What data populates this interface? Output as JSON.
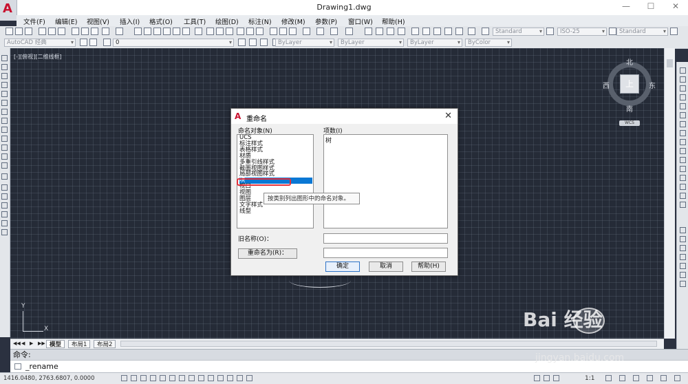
{
  "app": {
    "window_title": "Drawing1.dwg",
    "logo_letter": "A",
    "controls": {
      "minimize": "—",
      "maximize": "☐",
      "close": "✕"
    }
  },
  "menu": {
    "items": [
      "文件(F)",
      "编辑(E)",
      "视图(V)",
      "插入(I)",
      "格式(O)",
      "工具(T)",
      "绘图(D)",
      "标注(N)",
      "修改(M)",
      "参数(P)",
      "窗口(W)",
      "帮助(H)"
    ]
  },
  "toolbar": {
    "workspace": "AutoCAD 经典",
    "layer_zero": "0",
    "text_style": "Standard",
    "dim_style": "ISO-25",
    "table_style": "Standard",
    "layer_prop": "ByLayer",
    "linetype_prop": "ByLayer",
    "lineweight_prop": "ByLayer",
    "color_prop": "ByColor"
  },
  "viewport": {
    "label": "[-][俯视][二维线框]",
    "compass": {
      "north": "北",
      "south": "南",
      "east": "东",
      "west": "西",
      "center": "上"
    },
    "wcs": "WCS",
    "axis_y": "Y",
    "axis_x": "X"
  },
  "layout_tabs": {
    "nav": [
      "◀◀",
      "◀",
      "▶",
      "▶▶"
    ],
    "items": [
      "模型",
      "布局1",
      "布局2"
    ]
  },
  "command": {
    "history": "命令:",
    "input": "_rename"
  },
  "status": {
    "coords": "1416.0480, 2763.6807, 0.0000",
    "scale": "1:1"
  },
  "dialog": {
    "title": "重命名",
    "close": "✕",
    "named_objects_label": "命名对象(N)",
    "items_label": "项数(I)",
    "named_objects": [
      "UCS",
      "标注样式",
      "表格样式",
      "材质",
      "多重引线样式",
      "截面视图样式",
      "局部视图样式",
      "块",
      "视口",
      "视图",
      "图层",
      "文字样式",
      "线型"
    ],
    "selected_index": 7,
    "items": [
      "树"
    ],
    "tooltip": "按类别列出图形中的命名对象。",
    "old_name_label": "旧名称(O)：",
    "rename_to_button": "重命名为(R)：",
    "ok_button": "确定",
    "cancel_button": "取消",
    "help_button": "帮助(H)"
  },
  "watermark": {
    "main": "Bai 经验",
    "sub": "jingyan.baidu.com"
  }
}
